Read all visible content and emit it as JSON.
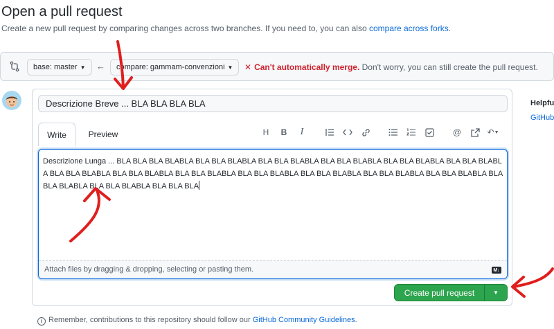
{
  "header": {
    "title": "Open a pull request",
    "subtitle": "Create a new pull request by comparing changes across two branches. If you need to, you can also ",
    "subtitle_link": "compare across forks",
    "subtitle_end": "."
  },
  "compare": {
    "base_label": "base: master",
    "compare_label": "compare: gammam-convenzioni",
    "merge_status": "Can't automatically merge.",
    "merge_hint": " Don't worry, you can still create the pull request."
  },
  "form": {
    "title_value": "Descrizione Breve ... BLA BLA BLA BLA",
    "tabs": [
      {
        "label": "Write"
      },
      {
        "label": "Preview"
      }
    ],
    "body_value": "Descrizione Lunga ... BLA BLA BLA BLABLA BLA BLA BLABLA BLA BLA BLABLA BLA BLA BLABLA BLA BLA BLABLA BLA BLA BLABLA BLA BLA BLABLA BLA BLA BLABLA BLA BLA BLABLA BLA BLA BLABLA BLA BLA BLABLA BLA BLA BLABLA BLA BLA BLABLA BLA BLA BLABLA BLA BLA BLABLA BLA BLA BLA",
    "attach_hint": "Attach files by dragging & dropping, selecting or pasting them.",
    "markdown_badge": "M↓",
    "submit_label": "Create pull request"
  },
  "sidebar": {
    "helpful_heading": "Helpful",
    "helpful_link": "GitHub"
  },
  "footer": {
    "note": "Remember, contributions to this repository should follow our ",
    "link": "GitHub Community Guidelines",
    "note_end": "."
  },
  "colors": {
    "accent": "#0969da",
    "success": "#2da44e",
    "danger": "#cf222e",
    "annotation": "#e01e1e"
  }
}
